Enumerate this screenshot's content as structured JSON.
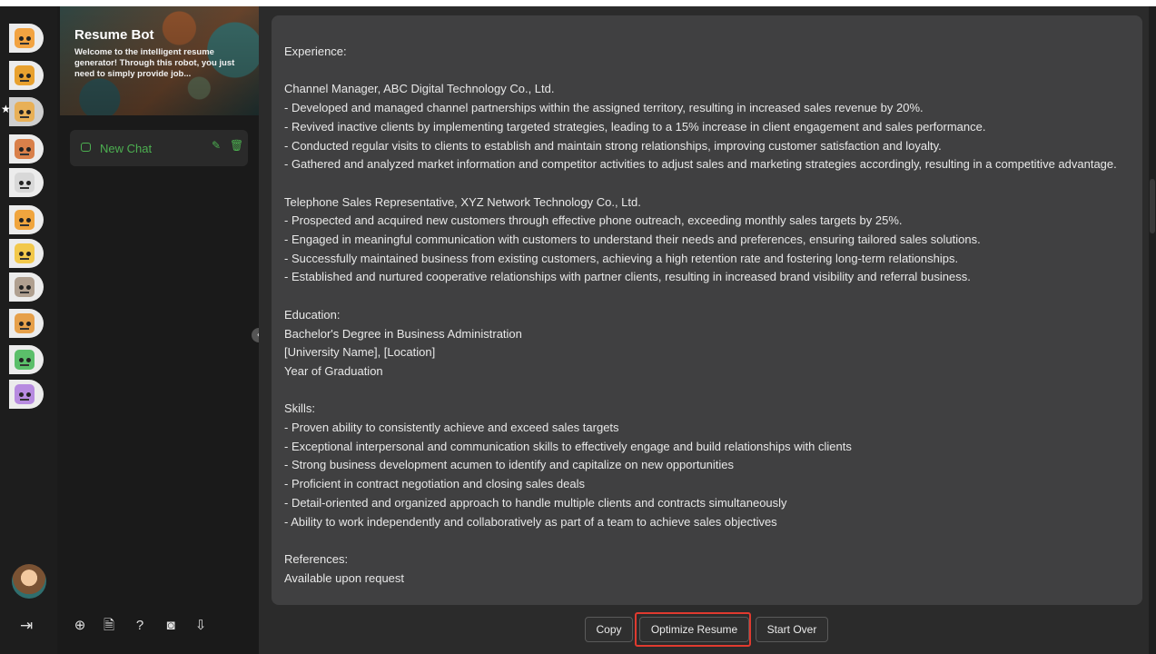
{
  "bots": [
    {
      "name": "bot-1",
      "color": "#f2a341"
    },
    {
      "name": "bot-2",
      "color": "#e8a12f"
    },
    {
      "name": "bot-3",
      "color": "#e8b057"
    },
    {
      "name": "bot-4",
      "color": "#d9804a"
    },
    {
      "name": "bot-5",
      "color": "#d8d8d8"
    },
    {
      "name": "bot-6",
      "color": "#f0a53e"
    },
    {
      "name": "bot-7",
      "color": "#f2c84b"
    },
    {
      "name": "bot-8",
      "color": "#b0a090"
    },
    {
      "name": "bot-9",
      "color": "#e6a04a"
    },
    {
      "name": "bot-10",
      "color": "#5bbf6a"
    },
    {
      "name": "bot-11",
      "color": "#b78be0"
    }
  ],
  "sidebar": {
    "bot_title": "Resume Bot",
    "bot_description": "Welcome to the intelligent resume generator! Through this robot, you just need to simply provide job...",
    "chat_label": "New Chat",
    "star": "★",
    "icons": {
      "edit": "✎",
      "delete": "🗑",
      "new": "⊕",
      "document": "🗎",
      "help": "?",
      "camera": "◙",
      "download": "⇩",
      "logout": "⇥",
      "collapse": "‹"
    }
  },
  "message": {
    "text": "Experience:\n\nChannel Manager, ABC Digital Technology Co., Ltd.\n- Developed and managed channel partnerships within the assigned territory, resulting in increased sales revenue by 20%.\n- Revived inactive clients by implementing targeted strategies, leading to a 15% increase in client engagement and sales performance.\n- Conducted regular visits to clients to establish and maintain strong relationships, improving customer satisfaction and loyalty.\n- Gathered and analyzed market information and competitor activities to adjust sales and marketing strategies accordingly, resulting in a competitive advantage.\n\nTelephone Sales Representative, XYZ Network Technology Co., Ltd.\n- Prospected and acquired new customers through effective phone outreach, exceeding monthly sales targets by 25%.\n- Engaged in meaningful communication with customers to understand their needs and preferences, ensuring tailored sales solutions.\n- Successfully maintained business from existing customers, achieving a high retention rate and fostering long-term relationships.\n- Established and nurtured cooperative relationships with partner clients, resulting in increased brand visibility and referral business.\n\nEducation:\nBachelor's Degree in Business Administration\n[University Name], [Location]\nYear of Graduation\n\nSkills:\n- Proven ability to consistently achieve and exceed sales targets\n- Exceptional interpersonal and communication skills to effectively engage and build relationships with clients\n- Strong business development acumen to identify and capitalize on new opportunities\n- Proficient in contract negotiation and closing sales deals\n- Detail-oriented and organized approach to handle multiple clients and contracts simultaneously\n- Ability to work independently and collaboratively as part of a team to achieve sales objectives\n\nReferences:\nAvailable upon request"
  },
  "actions": {
    "copy": "Copy",
    "optimize": "Optimize Resume",
    "start_over": "Start Over"
  },
  "colors": {
    "accent": "#4caf50",
    "highlight": "#e03a2f"
  }
}
